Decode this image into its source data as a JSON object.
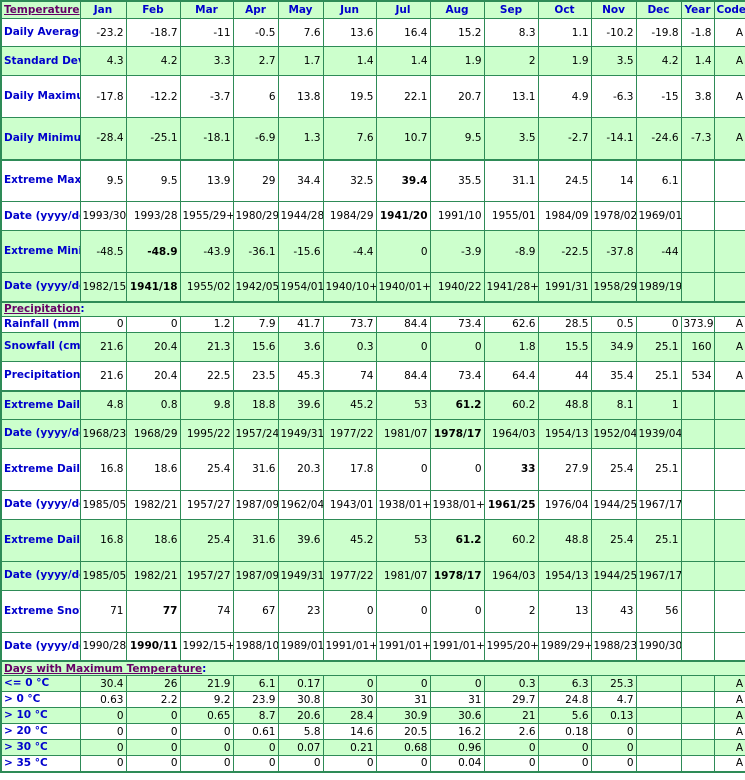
{
  "colors": {
    "border": "#2e8b57",
    "band": "#ccffcc",
    "label": "#0000cc",
    "section": "#660066"
  },
  "header": {
    "section": "Temperature",
    "columns": [
      "Jan",
      "Feb",
      "Mar",
      "Apr",
      "May",
      "Jun",
      "Jul",
      "Aug",
      "Sep",
      "Oct",
      "Nov",
      "Dec",
      "Year",
      "Code"
    ]
  },
  "temperature": [
    {
      "label": "Daily Average (°C)",
      "band": "w",
      "values": [
        "-23.2",
        "-18.7",
        "-11",
        "-0.5",
        "7.6",
        "13.6",
        "16.4",
        "15.2",
        "8.3",
        "1.1",
        "-10.2",
        "-19.8",
        "-1.8",
        "A"
      ],
      "bold": []
    },
    {
      "label": "Standard Deviation",
      "band": "g",
      "values": [
        "4.3",
        "4.2",
        "3.3",
        "2.7",
        "1.7",
        "1.4",
        "1.4",
        "1.9",
        "2",
        "1.9",
        "3.5",
        "4.2",
        "1.4",
        "A"
      ],
      "bold": []
    },
    {
      "label": "Daily Maximum (°C)",
      "band": "w",
      "values": [
        "-17.8",
        "-12.2",
        "-3.7",
        "6",
        "13.8",
        "19.5",
        "22.1",
        "20.7",
        "13.1",
        "4.9",
        "-6.3",
        "-15",
        "3.8",
        "A"
      ],
      "bold": []
    },
    {
      "label": "Daily Minimum (°C)",
      "band": "g",
      "values": [
        "-28.4",
        "-25.1",
        "-18.1",
        "-6.9",
        "1.3",
        "7.6",
        "10.7",
        "9.5",
        "3.5",
        "-2.7",
        "-14.1",
        "-24.6",
        "-7.3",
        "A"
      ],
      "bold": []
    },
    {
      "label": "Extreme Maximum (°C)",
      "band": "w",
      "thick": true,
      "values": [
        "9.5",
        "9.5",
        "13.9",
        "29",
        "34.4",
        "32.5",
        "39.4",
        "35.5",
        "31.1",
        "24.5",
        "14",
        "6.1",
        "",
        ""
      ],
      "bold": [
        6
      ]
    },
    {
      "label": "Date (yyyy/dd)",
      "band": "w",
      "values": [
        "1993/30",
        "1993/28",
        "1955/29+",
        "1980/29",
        "1944/28",
        "1984/29",
        "1941/20",
        "1991/10",
        "1955/01",
        "1984/09",
        "1978/02",
        "1969/01",
        "",
        ""
      ],
      "bold": [
        6
      ]
    },
    {
      "label": "Extreme Minimum (°C)",
      "band": "g",
      "values": [
        "-48.5",
        "-48.9",
        "-43.9",
        "-36.1",
        "-15.6",
        "-4.4",
        "0",
        "-3.9",
        "-8.9",
        "-22.5",
        "-37.8",
        "-44",
        "",
        ""
      ],
      "bold": [
        1
      ]
    },
    {
      "label": "Date (yyyy/dd)",
      "band": "g",
      "values": [
        "1982/15",
        "1941/18",
        "1955/02",
        "1942/05",
        "1954/01",
        "1940/10+",
        "1940/01+",
        "1940/22",
        "1941/28+",
        "1991/31",
        "1958/29",
        "1989/19",
        "",
        ""
      ],
      "bold": [
        1
      ]
    }
  ],
  "precipitation_section": "Precipitation",
  "precipitation": [
    {
      "label": "Rainfall (mm)",
      "band": "w",
      "values": [
        "0",
        "0",
        "1.2",
        "7.9",
        "41.7",
        "73.7",
        "84.4",
        "73.4",
        "62.6",
        "28.5",
        "0.5",
        "0",
        "373.9",
        "A"
      ],
      "bold": []
    },
    {
      "label": "Snowfall (cm)",
      "band": "g",
      "values": [
        "21.6",
        "20.4",
        "21.3",
        "15.6",
        "3.6",
        "0.3",
        "0",
        "0",
        "1.8",
        "15.5",
        "34.9",
        "25.1",
        "160",
        "A"
      ],
      "bold": []
    },
    {
      "label": "Precipitation (mm)",
      "band": "w",
      "values": [
        "21.6",
        "20.4",
        "22.5",
        "23.5",
        "45.3",
        "74",
        "84.4",
        "73.4",
        "64.4",
        "44",
        "35.4",
        "25.1",
        "534",
        "A"
      ],
      "bold": []
    },
    {
      "label": "Extreme Daily Rainfall (mm)",
      "band": "g",
      "thick": true,
      "values": [
        "4.8",
        "0.8",
        "9.8",
        "18.8",
        "39.6",
        "45.2",
        "53",
        "61.2",
        "60.2",
        "48.8",
        "8.1",
        "1",
        "",
        ""
      ],
      "bold": [
        7
      ]
    },
    {
      "label": "Date (yyyy/dd)",
      "band": "g",
      "values": [
        "1968/23",
        "1968/29",
        "1995/22",
        "1957/24",
        "1949/31",
        "1977/22",
        "1981/07",
        "1978/17",
        "1964/03",
        "1954/13",
        "1952/04",
        "1939/04",
        "",
        ""
      ],
      "bold": [
        7
      ]
    },
    {
      "label": "Extreme Daily Snowfall (cm)",
      "band": "w",
      "values": [
        "16.8",
        "18.6",
        "25.4",
        "31.6",
        "20.3",
        "17.8",
        "0",
        "0",
        "33",
        "27.9",
        "25.4",
        "25.1",
        "",
        ""
      ],
      "bold": [
        8
      ]
    },
    {
      "label": "Date (yyyy/dd)",
      "band": "w",
      "values": [
        "1985/05",
        "1982/21",
        "1957/27",
        "1987/09",
        "1962/04",
        "1943/01",
        "1938/01+",
        "1938/01+",
        "1961/25",
        "1976/04",
        "1944/25",
        "1967/17",
        "",
        ""
      ],
      "bold": [
        8
      ]
    },
    {
      "label": "Extreme Daily Precipitation (mm)",
      "band": "g",
      "values": [
        "16.8",
        "18.6",
        "25.4",
        "31.6",
        "39.6",
        "45.2",
        "53",
        "61.2",
        "60.2",
        "48.8",
        "25.4",
        "25.1",
        "",
        ""
      ],
      "bold": [
        7
      ]
    },
    {
      "label": "Date (yyyy/dd)",
      "band": "g",
      "values": [
        "1985/05",
        "1982/21",
        "1957/27",
        "1987/09",
        "1949/31",
        "1977/22",
        "1981/07",
        "1978/17",
        "1964/03",
        "1954/13",
        "1944/25",
        "1967/17",
        "",
        ""
      ],
      "bold": [
        7
      ]
    },
    {
      "label": "Extreme Snow Depth (cm)",
      "band": "w",
      "values": [
        "71",
        "77",
        "74",
        "67",
        "23",
        "0",
        "0",
        "0",
        "2",
        "13",
        "43",
        "56",
        "",
        ""
      ],
      "bold": [
        1
      ]
    },
    {
      "label": "Date (yyyy/dd)",
      "band": "w",
      "values": [
        "1990/28",
        "1990/11",
        "1992/15+",
        "1988/10",
        "1989/01",
        "1991/01+",
        "1991/01+",
        "1991/01+",
        "1995/20+",
        "1989/29+",
        "1988/23",
        "1990/30",
        "",
        ""
      ],
      "bold": [
        1
      ]
    }
  ],
  "days_section": "Days with Maximum Temperature",
  "days": [
    {
      "label": "<= 0 °C",
      "band": "g",
      "values": [
        "30.4",
        "26",
        "21.9",
        "6.1",
        "0.17",
        "0",
        "0",
        "0",
        "0.3",
        "6.3",
        "25.3",
        "",
        "",
        "A"
      ],
      "bold": []
    },
    {
      "label": "> 0 °C",
      "band": "w",
      "values": [
        "0.63",
        "2.2",
        "9.2",
        "23.9",
        "30.8",
        "30",
        "31",
        "31",
        "29.7",
        "24.8",
        "4.7",
        "",
        "",
        "A"
      ],
      "bold": []
    },
    {
      "label": "> 10 °C",
      "band": "g",
      "values": [
        "0",
        "0",
        "0.65",
        "8.7",
        "20.6",
        "28.4",
        "30.9",
        "30.6",
        "21",
        "5.6",
        "0.13",
        "",
        "",
        "A"
      ],
      "bold": []
    },
    {
      "label": "> 20 °C",
      "band": "w",
      "values": [
        "0",
        "0",
        "0",
        "0.61",
        "5.8",
        "14.6",
        "20.5",
        "16.2",
        "2.6",
        "0.18",
        "0",
        "",
        "",
        "A"
      ],
      "bold": []
    },
    {
      "label": "> 30 °C",
      "band": "g",
      "values": [
        "0",
        "0",
        "0",
        "0",
        "0.07",
        "0.21",
        "0.68",
        "0.96",
        "0",
        "0",
        "0",
        "",
        "",
        "A"
      ],
      "bold": []
    },
    {
      "label": "> 35 °C",
      "band": "w",
      "values": [
        "0",
        "0",
        "0",
        "0",
        "0",
        "0",
        "0",
        "0.04",
        "0",
        "0",
        "0",
        "",
        "",
        "A"
      ],
      "bold": []
    }
  ]
}
